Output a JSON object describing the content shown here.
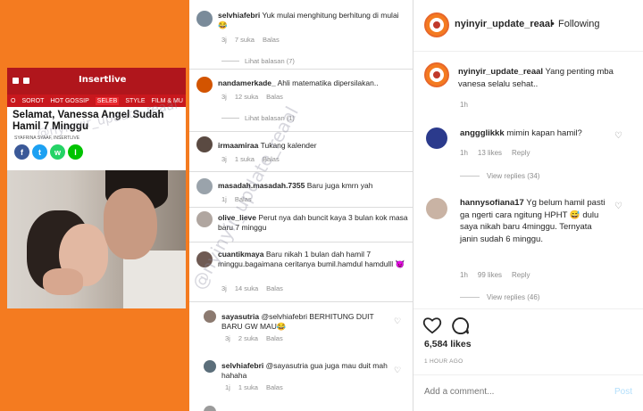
{
  "article": {
    "site_logo": "Insertlive",
    "nav": [
      "SOROT",
      "HOT GOSSIP",
      "SELEB",
      "STYLE",
      "FILM & MU"
    ],
    "nav_home": "O",
    "headline": "Selamat, Vanessa Angel Sudah Hamil 7 Minggu",
    "byline": "SYAFRINA SYAAF, INSERTLIVE",
    "share": [
      "f",
      "t",
      "w",
      "l"
    ]
  },
  "watermark": "@nyinyir_update_reaal",
  "comments": [
    {
      "user": "selvhiafebri",
      "text": "Yuk mulai menghitung berhitung di mulai 😂",
      "time": "3j",
      "likes": "7 suka",
      "reply": "Balas"
    },
    {
      "lihat": "Lihat balasan (7)"
    },
    {
      "user": "nandamerkade_",
      "text": "Ahli matematika dipersilakan..",
      "time": "3j",
      "likes": "12 suka",
      "reply": "Balas"
    },
    {
      "lihat": "Lihat balasan (1)"
    },
    {
      "user": "irmaamiraa",
      "text": "Tukang kalender",
      "time": "3j",
      "likes": "1 suka",
      "reply": "Balas"
    },
    {
      "user": "masadah.masadah.7355",
      "text": "Baru juga kmrn yah",
      "time": "1j",
      "likes": "",
      "reply": "Balas"
    },
    {
      "user": "olive_lieve",
      "text": "Perut nya dah buncit kaya 3 bulan kok masa baru 7 minggu",
      "time": "",
      "likes": "",
      "reply": ""
    },
    {
      "user": "cuantikmaya",
      "text": "Baru nikah 1 bulan dah hamil 7 minggu.bagaimana ceritanya bumil.hamdul hamdulll 😈",
      "time": "3j",
      "likes": "14 suka",
      "reply": "Balas"
    },
    {
      "user": "sayasutria",
      "text": "@selvhiafebri  BERHITUNG DUIT BARU GW MAU😂",
      "time": "3j",
      "likes": "2 suka",
      "reply": "Balas"
    },
    {
      "user": "selvhiafebri",
      "text": "@sayasutria gua juga mau duit mah hahaha",
      "time": "1j",
      "likes": "1 suka",
      "reply": "Balas"
    }
  ],
  "instagram": {
    "username": "nyinyir_update_reaal",
    "dot": "•",
    "follow_status": "Following",
    "caption_user": "nyinyir_update_reaal",
    "caption_text": "Yang penting mba vanesa selalu sehat..",
    "caption_time": "1h",
    "comments": [
      {
        "user": "anggglikkk",
        "text": "mimin kapan hamil?",
        "time": "1h",
        "likes": "13 likes",
        "reply": "Reply",
        "view": "View replies (34)"
      },
      {
        "user": "hannysofiana17",
        "text": "Yg belum hamil pasti ga ngerti cara ngitung HPHT 😅 dulu saya nikah baru 4minggu. Ternyata janin sudah 6 minggu.",
        "time": "1h",
        "likes": "99 likes",
        "reply": "Reply",
        "view": "View replies (46)"
      }
    ],
    "likes": "6,584 likes",
    "time_ago": "1 HOUR AGO",
    "add_comment_placeholder": "Add a comment...",
    "post_label": "Post"
  },
  "colors": {
    "orange": "#f47b20",
    "insertlive_red": "#b0161c",
    "ig_blue": "#b2dffc"
  }
}
